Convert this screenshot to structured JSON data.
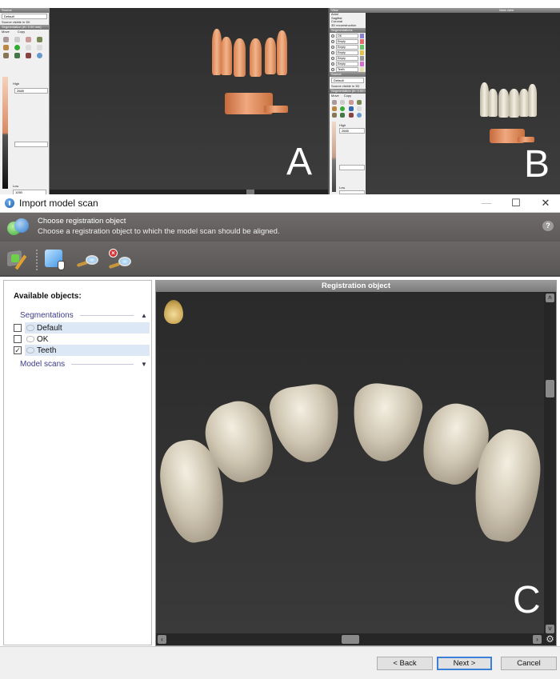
{
  "panel_a": {
    "letter": "A",
    "source_header": "Source",
    "source_select": "Default",
    "source_visible_label": "Source visible in 3D",
    "segmentation_header": "Segmentation (th: 0.00 mm)",
    "mode_move": "Move",
    "mode_copy": "Copy",
    "high_label": "High",
    "high_value": "2665",
    "low_label": "Low",
    "low_value": "1050"
  },
  "panel_b": {
    "letter": "B",
    "view_header": "View",
    "view_options": [
      "Axial",
      "Sagittal",
      "Coronal",
      "3D reconstruction"
    ],
    "segmentations_header": "Segmentations",
    "segmentations": [
      {
        "name": "OK",
        "color": "#8a7fd6"
      },
      {
        "name": "Empty",
        "color": "#e36b6b"
      },
      {
        "name": "Empty",
        "color": "#6bc46b"
      },
      {
        "name": "Empty",
        "color": "#e2c44c"
      },
      {
        "name": "Empty",
        "color": "#999999"
      },
      {
        "name": "Empty",
        "color": "#d46fd0"
      },
      {
        "name": "Teeth",
        "color": "#e8e0b0"
      }
    ],
    "source_header": "Source",
    "source_select": "Default",
    "source_visible_label": "Source visible in 3D",
    "segmentation_header": "Segmentation (th: 0.00 mm)",
    "mode_move": "Move",
    "mode_copy": "Copy",
    "high_label": "High",
    "high_value": "2665",
    "low_label": "Low",
    "viewport_title": "Main view"
  },
  "dialog": {
    "title": "Import model scan",
    "minimize": "—",
    "maximize": "☐",
    "close": "✕",
    "step_title": "Choose registration object",
    "step_desc": "Choose a registration object to which the model scan should be aligned.",
    "help_icon": "?",
    "toolbar": [
      {
        "name": "segment-edit-icon",
        "tooltip": "Edit segmentation"
      },
      {
        "name": "select-object-icon",
        "tooltip": "Select object"
      },
      {
        "name": "zoom-icon",
        "tooltip": "Zoom"
      },
      {
        "name": "zoom-reset-icon",
        "tooltip": "Reset zoom"
      }
    ],
    "available_title": "Available objects:",
    "groups": [
      {
        "label": "Segmentations",
        "expanded": true,
        "chevron": "▲"
      },
      {
        "label": "Model scans",
        "expanded": false,
        "chevron": "▼"
      }
    ],
    "items": [
      {
        "label": "Default",
        "checked": false,
        "highlight": true
      },
      {
        "label": "OK",
        "checked": false,
        "highlight": false
      },
      {
        "label": "Teeth",
        "checked": true,
        "highlight": true
      }
    ],
    "registration_header": "Registration object",
    "viewport_letter": "C",
    "back_label": "< Back",
    "next_label": "Next >",
    "cancel_label": "Cancel"
  }
}
